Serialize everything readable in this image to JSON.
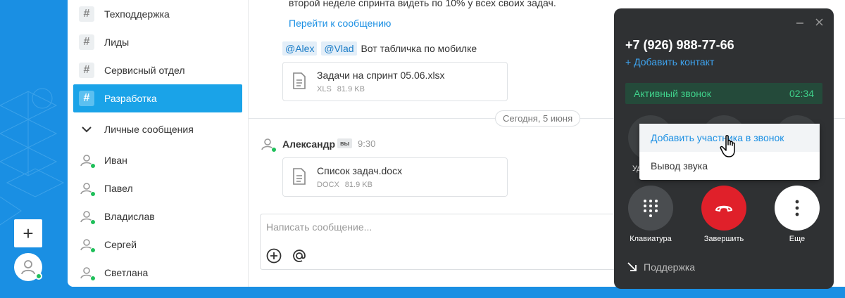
{
  "sidebar": {
    "channels": [
      {
        "label": "Техподдержка"
      },
      {
        "label": "Лиды"
      },
      {
        "label": "Сервисный отдел"
      },
      {
        "label": "Разработка",
        "active": true
      }
    ],
    "personal_header": "Личные сообщения",
    "users": [
      {
        "label": "Иван"
      },
      {
        "label": "Павел"
      },
      {
        "label": "Владислав"
      },
      {
        "label": "Сергей"
      },
      {
        "label": "Светлана"
      }
    ]
  },
  "chat": {
    "msg_top_text": "второй неделе спринта видеть по 10% у всех своих задач.",
    "goto_link": "Перейти к сообщению",
    "mentions": [
      "@Alex",
      "@Vlad"
    ],
    "mention_text": "Вот табличка по мобилке",
    "file1": {
      "name": "Задачи на спринт 05.06.xlsx",
      "type": "XLS",
      "size": "81.9 KB"
    },
    "date_divider": "Сегодня, 5 июня",
    "author": "Александр",
    "you_badge": "вы",
    "time": "9:30",
    "file2": {
      "name": "Список задач.docx",
      "type": "DOCX",
      "size": "81.9 KB"
    },
    "composer_placeholder": "Написать сообщение..."
  },
  "call": {
    "phone": "+7 (926) 988-77-66",
    "add_contact": "+ Добавить контакт",
    "status": "Активный звонок",
    "duration": "02:34",
    "hidden_label": "Уд",
    "keypad_label": "Клавиатура",
    "end_label": "Завершить",
    "more_label": "Еще",
    "support": "Поддержка",
    "colors": {
      "panel": "#2f3133",
      "end": "#e0202a",
      "active_text": "#3fd08a",
      "link": "#3ea4f0"
    }
  },
  "menu": {
    "items": [
      {
        "label": "Добавить участника в звонок",
        "hover": true
      },
      {
        "label": "Вывод звука"
      }
    ]
  },
  "colors": {
    "accent": "#1aa3e8",
    "background": "#1a8fe3",
    "online": "#1fbf5a"
  }
}
